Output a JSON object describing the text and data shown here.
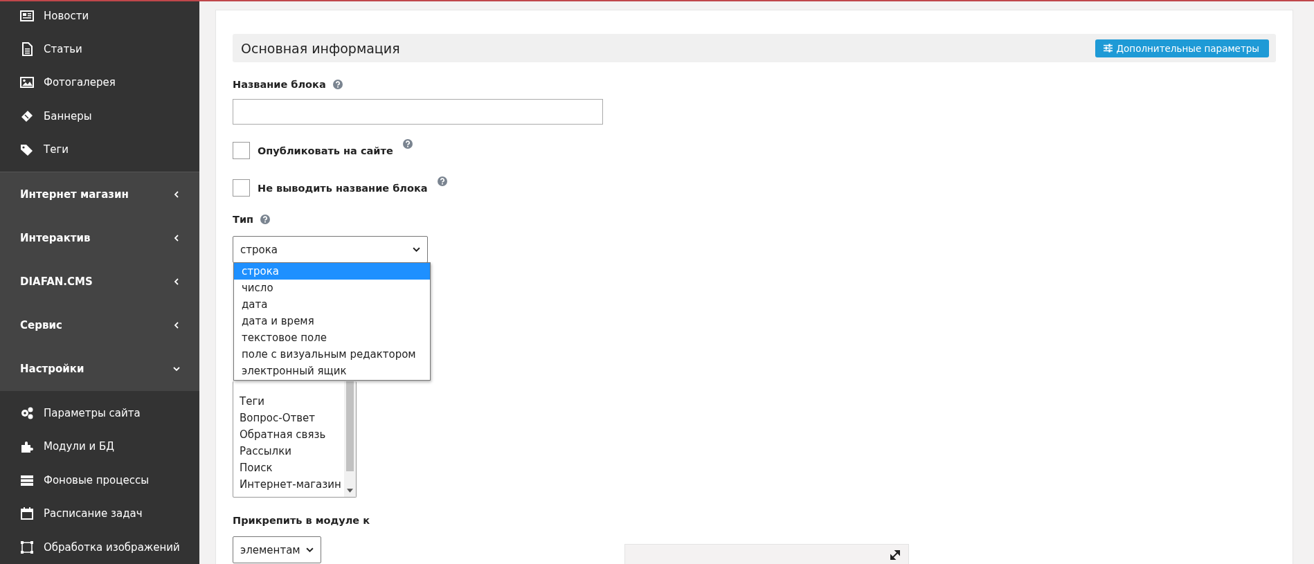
{
  "sidebar": {
    "items": [
      {
        "kind": "link",
        "label": "Новости"
      },
      {
        "kind": "link",
        "label": "Статьи"
      },
      {
        "kind": "link",
        "label": "Фотогалерея"
      },
      {
        "kind": "link",
        "label": "Баннеры"
      },
      {
        "kind": "link",
        "label": "Теги"
      },
      {
        "kind": "group",
        "label": "Интернет магазин",
        "expanded": false
      },
      {
        "kind": "group",
        "label": "Интерактив",
        "expanded": false
      },
      {
        "kind": "group",
        "label": "DIAFAN.CMS",
        "expanded": false
      },
      {
        "kind": "group",
        "label": "Сервис",
        "expanded": false
      },
      {
        "kind": "group",
        "label": "Настройки",
        "expanded": true
      },
      {
        "kind": "link",
        "label": "Параметры сайта"
      },
      {
        "kind": "link",
        "label": "Модули и БД"
      },
      {
        "kind": "link",
        "label": "Фоновые процессы"
      },
      {
        "kind": "link",
        "label": "Расписание задач"
      },
      {
        "kind": "link",
        "label": "Обработка изображений"
      }
    ]
  },
  "section": {
    "title": "Основная информация",
    "button": "Дополнительные параметры"
  },
  "form": {
    "name_label": "Название блока",
    "checkboxes": [
      {
        "label": "Опубликовать на сайте",
        "checked": false
      },
      {
        "label": "Не выводить название блока",
        "checked": false
      }
    ],
    "type_label": "Тип",
    "type_value": "строка",
    "type_options": [
      {
        "label": "строка",
        "selected": true
      },
      {
        "label": "число",
        "selected": false
      },
      {
        "label": "дата",
        "selected": false
      },
      {
        "label": "дата и время",
        "selected": false
      },
      {
        "label": "текстовое поле",
        "selected": false
      },
      {
        "label": "поле с визуальным редактором",
        "selected": false
      },
      {
        "label": "электронный ящик",
        "selected": false
      }
    ],
    "modules": [
      "Теги",
      "Вопрос-Ответ",
      "Обратная связь",
      "Рассылки",
      "Поиск",
      "Интернет-магазин"
    ],
    "attach_label": "Прикрепить в модуле к",
    "attach_value": "элементам"
  }
}
